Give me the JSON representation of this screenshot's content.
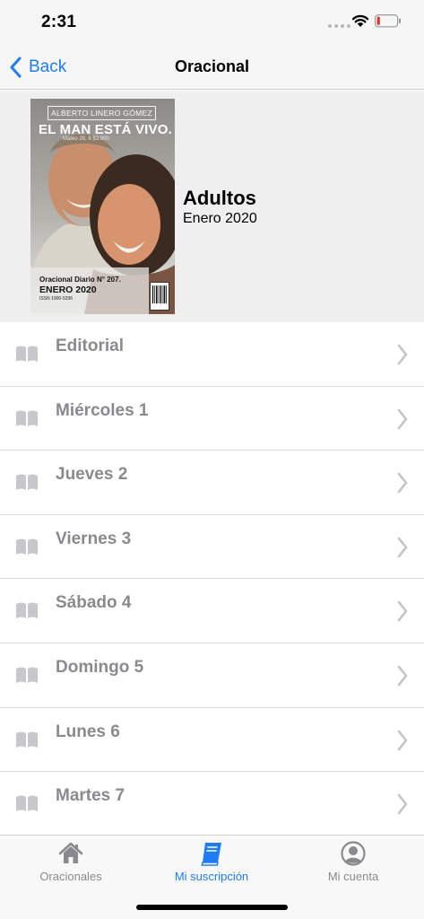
{
  "status": {
    "time": "2:31"
  },
  "nav": {
    "back_label": "Back",
    "title": "Oracional"
  },
  "cover": {
    "author": "ALBERTO LINERO GÓMEZ",
    "title": "EL MAN ESTÁ VIVO.",
    "subtitle": "Mateo 28, 6   $3.000",
    "series": "Oracional Diario N° 207.",
    "month": "ENERO 2020",
    "issn": "ISSN 1900-5296"
  },
  "edition": {
    "title": "Adultos",
    "date": "Enero 2020"
  },
  "entries": [
    {
      "label": "Editorial"
    },
    {
      "label": "Miércoles 1"
    },
    {
      "label": "Jueves 2"
    },
    {
      "label": "Viernes 3"
    },
    {
      "label": "Sábado 4"
    },
    {
      "label": "Domingo 5"
    },
    {
      "label": "Lunes 6"
    },
    {
      "label": "Martes 7"
    }
  ],
  "tabs": [
    {
      "label": "Oracionales",
      "icon": "home-icon"
    },
    {
      "label": "Mi suscripción",
      "icon": "book-icon",
      "active": true
    },
    {
      "label": "Mi cuenta",
      "icon": "person-circle-icon"
    }
  ],
  "colors": {
    "accent": "#1f7cf2",
    "inactive": "#8a8a8e",
    "header_bg": "#efeff0"
  }
}
